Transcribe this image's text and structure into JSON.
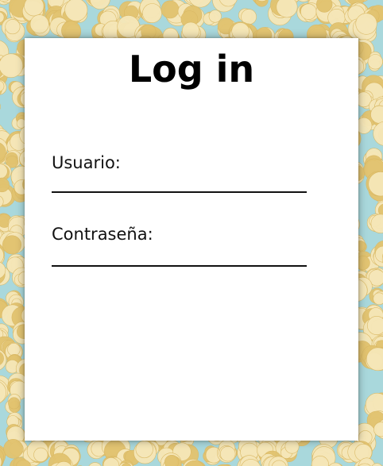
{
  "login_form": {
    "title": "Log in",
    "username_label": "Usuario:",
    "username_value": "",
    "password_label": "Contraseña:",
    "password_value": ""
  },
  "colors": {
    "background": "#a9d8dc",
    "popcorn": "#f6e7b8",
    "popcorn_shade": "#e2c36f",
    "card": "#ffffff",
    "text": "#000000"
  }
}
